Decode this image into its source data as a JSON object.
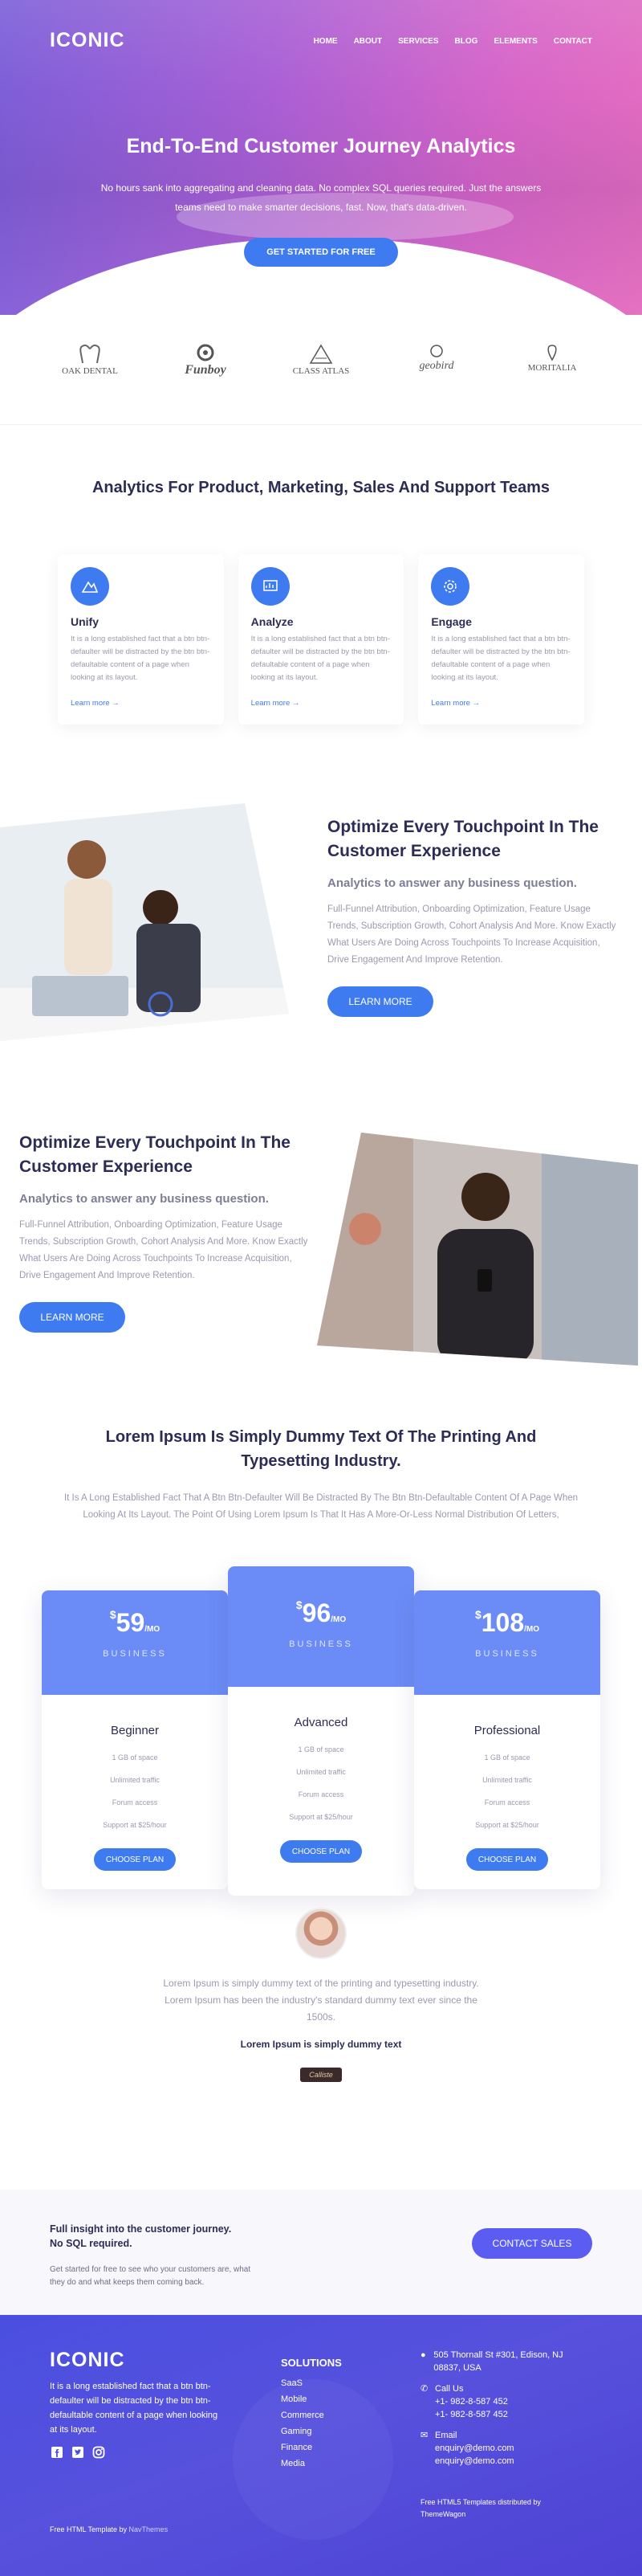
{
  "brand": "ICONIC",
  "nav": [
    "HOME",
    "ABOUT",
    "SERVICES",
    "BLOG",
    "ELEMENTS",
    "CONTACT"
  ],
  "hero": {
    "title": "End-To-End Customer Journey Analytics",
    "subtitle": "No hours sank into aggregating and cleaning data. No complex SQL queries required. Just the answers teams need to make smarter decisions, fast. Now, that's data-driven.",
    "cta": "GET STARTED FOR FREE"
  },
  "partners": [
    "OAK DENTAL",
    "Funboy",
    "CLASS ATLAS",
    "geobird",
    "MORITALIA"
  ],
  "features_section": {
    "title": "Analytics For Product, Marketing, Sales And Support Teams",
    "cards": [
      {
        "title": "Unify",
        "text": "It is a long established fact that a btn btn-defaulter will be distracted by the btn btn-defaultable content of a page when looking at its layout.",
        "link": "Learn more →",
        "icon": "mountain-icon"
      },
      {
        "title": "Analyze",
        "text": "It is a long established fact that a btn btn-defaulter will be distracted by the btn btn-defaultable content of a page when looking at its layout.",
        "link": "Learn more →",
        "icon": "chart-icon"
      },
      {
        "title": "Engage",
        "text": "It is a long established fact that a btn btn-defaulter will be distracted by the btn btn-defaultable content of a page when looking at its layout.",
        "link": "Learn more →",
        "icon": "gear-icon"
      }
    ]
  },
  "block1": {
    "title": "Optimize Every Touchpoint In The Customer Experience",
    "subtitle": "Analytics to answer any business question.",
    "text": "Full-Funnel Attribution, Onboarding Optimization, Feature Usage Trends, Subscription Growth, Cohort Analysis And More. Know Exactly What Users Are Doing Across Touchpoints To Increase Acquisition, Drive Engagement And Improve Retention.",
    "button": "LEARN MORE"
  },
  "block2": {
    "title": "Optimize Every Touchpoint In The Customer Experience",
    "subtitle": "Analytics to answer any business question.",
    "text": "Full-Funnel Attribution, Onboarding Optimization, Feature Usage Trends, Subscription Growth, Cohort Analysis And More. Know Exactly What Users Are Doing Across Touchpoints To Increase Acquisition, Drive Engagement And Improve Retention.",
    "button": "LEARN MORE"
  },
  "pricing": {
    "title": "Lorem Ipsum Is Simply Dummy Text Of The Printing And Typesetting Industry.",
    "text": "It Is A Long Established Fact That A Btn Btn-Defaulter Will Be Distracted By The Btn Btn-Defaultable Content Of A Page When Looking At Its Layout. The Point Of Using Lorem Ipsum Is That It Has A More-Or-Less Normal Distribution Of Letters,",
    "plans": [
      {
        "currency": "$",
        "price": "59",
        "period": "/MO",
        "tier": "BUSINESS",
        "name": "Beginner",
        "features": [
          "1 GB of space",
          "Unlimited traffic",
          "Forum access",
          "Support at $25/hour"
        ],
        "button": "CHOOSE PLAN"
      },
      {
        "currency": "$",
        "price": "96",
        "period": "/MO",
        "tier": "BUSINESS",
        "name": "Advanced",
        "features": [
          "1 GB of space",
          "Unlimited traffic",
          "Forum access",
          "Support at $25/hour"
        ],
        "button": "CHOOSE PLAN"
      },
      {
        "currency": "$",
        "price": "108",
        "period": "/MO",
        "tier": "BUSINESS",
        "name": "Professional",
        "features": [
          "1 GB of space",
          "Unlimited traffic",
          "Forum access",
          "Support at $25/hour"
        ],
        "button": "CHOOSE PLAN"
      }
    ]
  },
  "testimonial": {
    "text": "Lorem Ipsum is simply dummy text of the printing and typesetting industry. Lorem Ipsum has been the industry's standard dummy text ever since the 1500s.",
    "name": "Lorem Ipsum is simply dummy text",
    "signature": "Calliste"
  },
  "cta": {
    "title": "Full insight into the customer journey. No SQL required.",
    "text": "Get started for free to see who your customers are, what they do and what keeps them coming back.",
    "button": "CONTACT SALES"
  },
  "footer": {
    "brand": "ICONIC",
    "desc": "It is a long established fact that a btn btn-defaulter will be distracted by the btn btn-defaultable content of a page when looking at its layout.",
    "copy_prefix": "Free HTML Template by ",
    "copy_link": "NavThemes",
    "solutions_title": "SOLUTIONS",
    "solutions": [
      "SaaS",
      "Mobile",
      "Commerce",
      "Gaming",
      "Finance",
      "Media"
    ],
    "address": "505 Thornall St #301, Edison, NJ 08837, USA",
    "call_label": "Call Us",
    "phones": [
      "+1- 982-8-587 452",
      "+1- 982-8-587 452"
    ],
    "email_label": "Email",
    "emails": [
      "enquiry@demo.com",
      "enquiry@demo.com"
    ],
    "credit_prefix": "Free HTML5 Templates ",
    "credit_suffix": "distributed by ",
    "credit_link": "ThemeWagon"
  },
  "colors": {
    "accent": "#3e7bf0",
    "plan_header": "#6b8cf6",
    "footer": "#4a4fe0"
  }
}
